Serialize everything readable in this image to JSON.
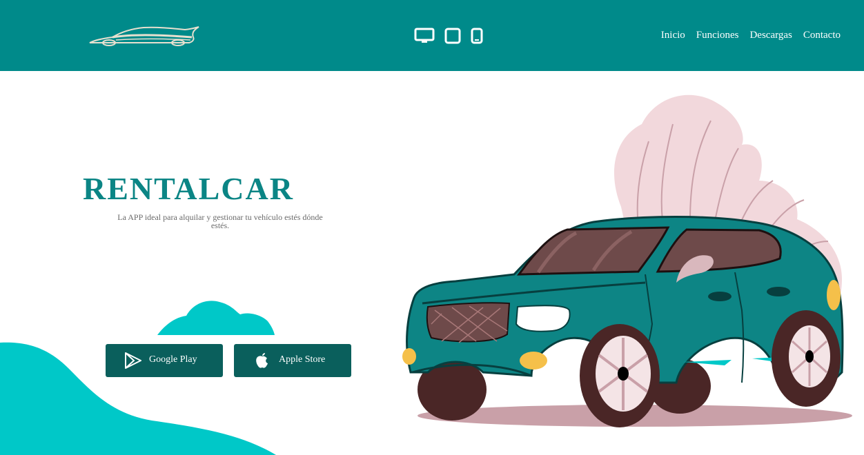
{
  "brand": {
    "logo_icon": "car-silhouette-logo"
  },
  "header": {
    "device_icons": [
      "desktop-icon",
      "tablet-icon",
      "phone-icon"
    ],
    "nav": [
      {
        "label": "Inicio"
      },
      {
        "label": "Funciones"
      },
      {
        "label": "Descargas"
      },
      {
        "label": "Contacto"
      }
    ]
  },
  "hero": {
    "title": "RENTALCAR",
    "subtitle": "La APP ideal para alquilar y gestionar tu vehículo estés dónde estés."
  },
  "downloads": {
    "google_label": "Google Play",
    "apple_label": "Apple Store",
    "google_icon": "google-play-icon",
    "apple_icon": "apple-icon"
  },
  "colors": {
    "header_bg": "#008a8a",
    "title": "#0b8585",
    "button_bg": "#0a5f5c",
    "wave": "#00c8c8",
    "car_body": "#0d8585",
    "bush": "#f2d8dc"
  }
}
